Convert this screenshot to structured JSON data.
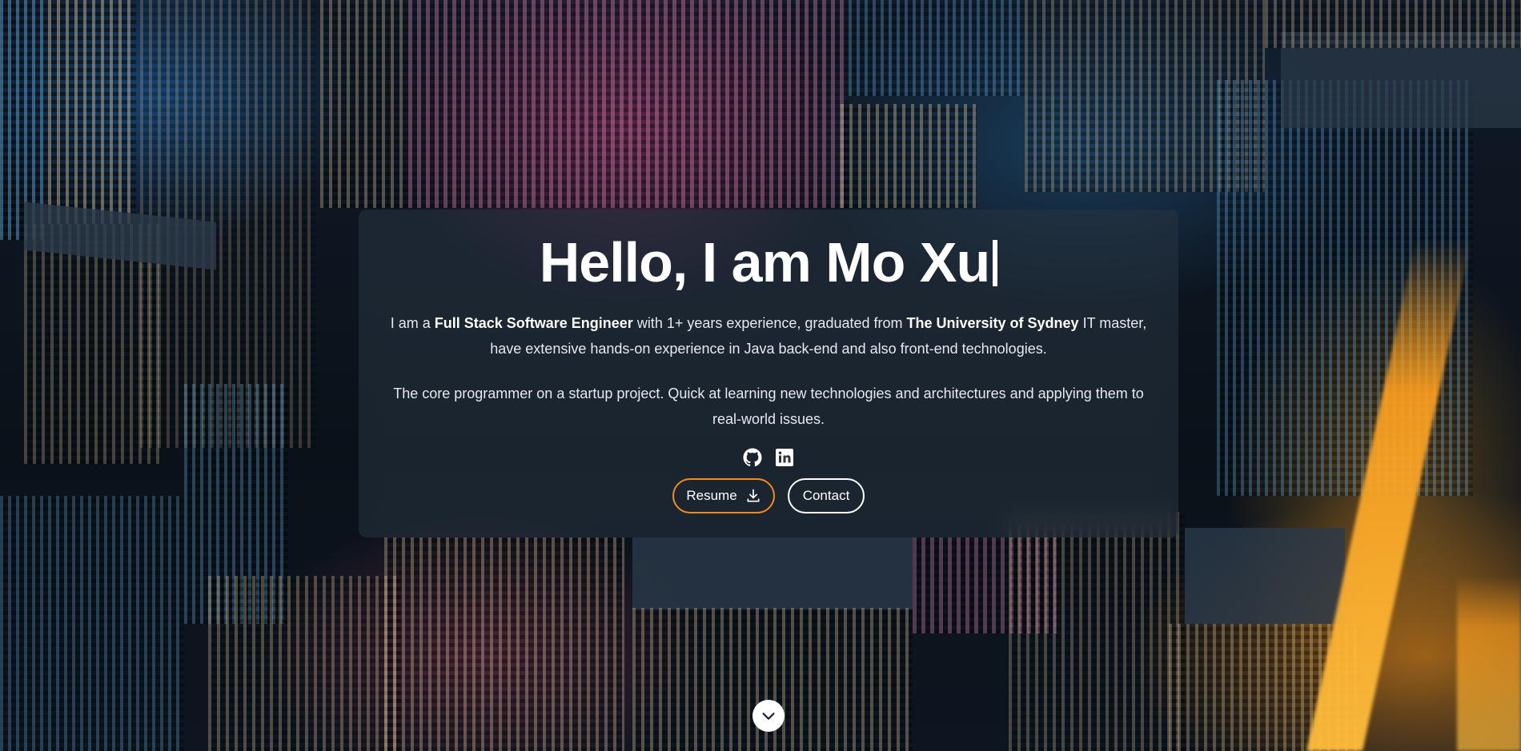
{
  "hero": {
    "title": "Hello, I am Mo Xu",
    "intro": {
      "t1": "I am a ",
      "role": "Full Stack Software Engineer",
      "t2": " with 1+ years experience, graduated from ",
      "school": "The University of Sydney",
      "t3": " IT master, have extensive hands-on experience in Java back-end and also front-end technologies."
    },
    "summary": "The core programmer on a startup project. Quick at learning new technologies and architectures and applying them to real-world issues."
  },
  "social": [
    {
      "icon": "github-icon"
    },
    {
      "icon": "linkedin-icon"
    }
  ],
  "buttons": {
    "resume_label": "Resume",
    "contact_label": "Contact"
  },
  "scroll_icon": "chevron-down-icon",
  "colors": {
    "resume_border": "#f58a1f",
    "card_bg": "rgba(40,52,66,0.55)",
    "text": "#ffffff"
  }
}
